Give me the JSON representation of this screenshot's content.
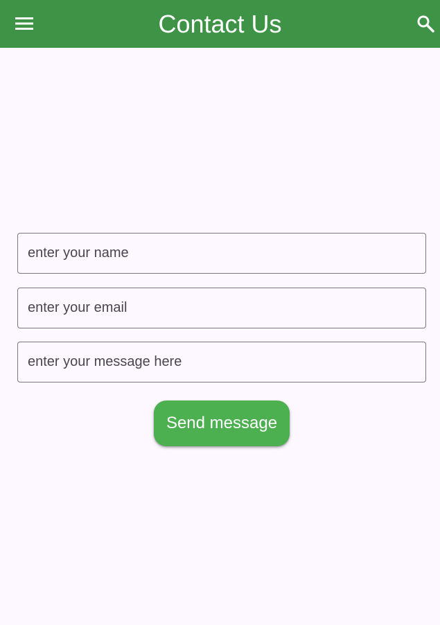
{
  "appbar": {
    "title": "Contact Us",
    "menu_icon": "menu-icon",
    "search_icon": "search-icon",
    "background": "#3f9346"
  },
  "form": {
    "name_placeholder": "enter your name",
    "email_placeholder": "enter your email",
    "message_placeholder": "enter your message here",
    "send_label": "Send message",
    "button_color": "#4caf50"
  }
}
